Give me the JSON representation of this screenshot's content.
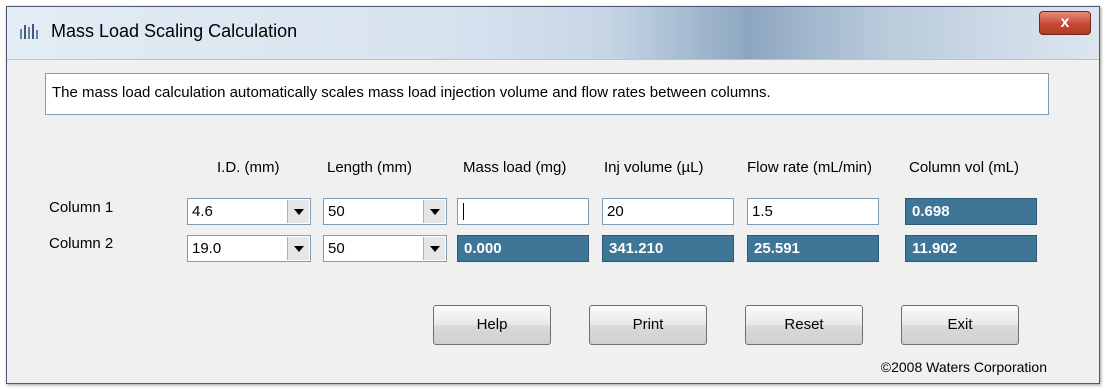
{
  "window": {
    "title": "Mass Load Scaling Calculation",
    "icon": "waters-app-icon",
    "close_label": "x"
  },
  "description": "The mass load calculation automatically scales mass load injection volume and flow rates between columns.",
  "headers": {
    "id": "I.D. (mm)",
    "length": "Length (mm)",
    "mass_load": "Mass load (mg)",
    "inj_volume": "Inj volume (µL)",
    "flow_rate": "Flow rate (mL/min)",
    "column_vol": "Column vol (mL)"
  },
  "rows": [
    {
      "label": "Column 1",
      "id": "4.6",
      "length": "50",
      "mass_load": "",
      "inj_volume": "20",
      "flow_rate": "1.5",
      "column_vol": "0.698"
    },
    {
      "label": "Column 2",
      "id": "19.0",
      "length": "50",
      "mass_load": "0.000",
      "inj_volume": "341.210",
      "flow_rate": "25.591",
      "column_vol": "11.902"
    }
  ],
  "buttons": {
    "help": "Help",
    "print": "Print",
    "reset": "Reset",
    "exit": "Exit"
  },
  "copyright": "©2008 Waters Corporation",
  "colors": {
    "output_field": "#3f7698",
    "close_button": "#c64a33"
  }
}
